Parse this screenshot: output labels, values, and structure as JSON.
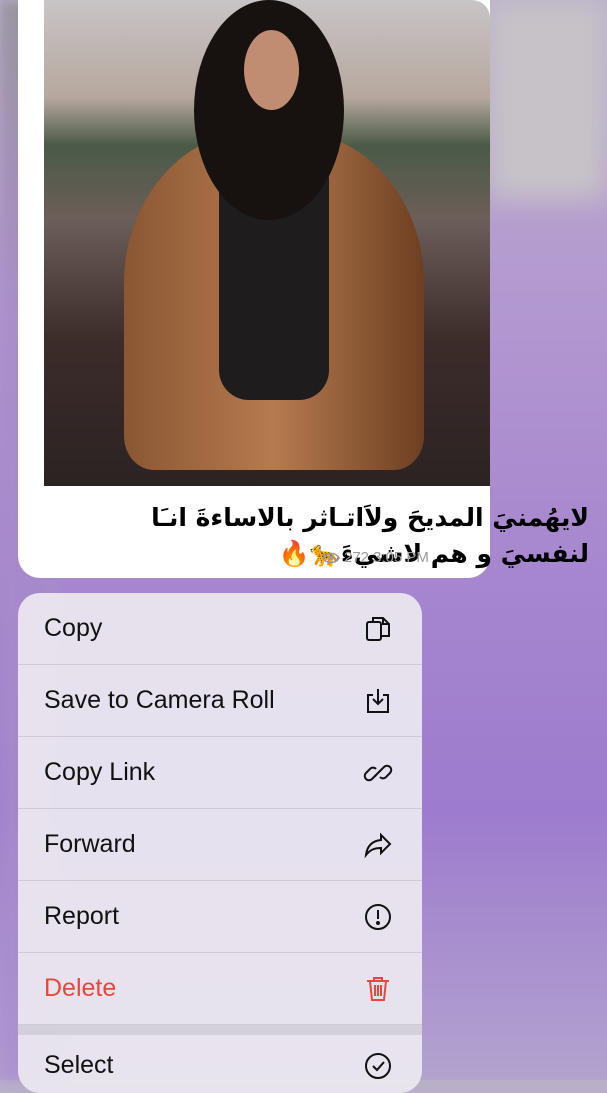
{
  "message": {
    "caption": "لايهُمنيَ المديحَ ولاَاتـاثر بالاساءةَ انـَا لنفسيَ و هم لاشيءَ🐆🔥",
    "views": "272",
    "time": "3:05 PM"
  },
  "menu": {
    "items": [
      {
        "label": "Copy",
        "icon": "copy-icon"
      },
      {
        "label": "Save to Camera Roll",
        "icon": "download-icon"
      },
      {
        "label": "Copy Link",
        "icon": "link-icon"
      },
      {
        "label": "Forward",
        "icon": "forward-icon"
      },
      {
        "label": "Report",
        "icon": "report-icon"
      },
      {
        "label": "Delete",
        "icon": "trash-icon",
        "color": "#e8473d"
      },
      {
        "label": "Select",
        "icon": "check-circle-icon"
      }
    ]
  }
}
